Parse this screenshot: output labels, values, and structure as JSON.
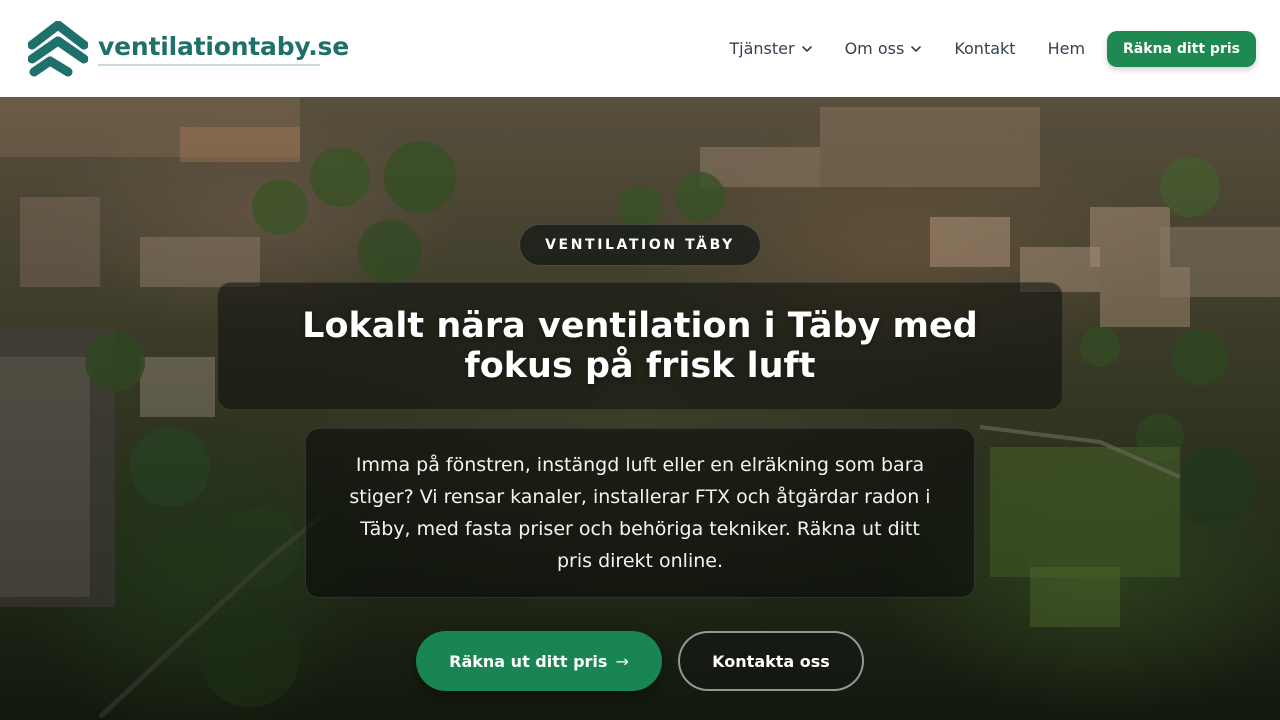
{
  "header": {
    "logo_text": "ventilationtaby.se",
    "logo_icon": "stacked-chevron-roof-icon",
    "nav": [
      {
        "label": "Tjänster",
        "has_dropdown": true
      },
      {
        "label": "Om oss",
        "has_dropdown": true
      },
      {
        "label": "Kontakt",
        "has_dropdown": false
      },
      {
        "label": "Hem",
        "has_dropdown": false
      }
    ],
    "cta_label": "Räkna ditt pris"
  },
  "hero": {
    "eyebrow": "VENTILATION TÄBY",
    "title": "Lokalt nära ventilation i Täby med fokus på frisk luft",
    "description": "Imma på fönstren, instängd luft eller en elräkning som bara stiger? Vi rensar kanaler, installerar FTX och åtgärdar radon i Täby, med fasta priser och behöriga tekniker. Räkna ut ditt pris direkt online.",
    "primary_button": "Räkna ut ditt pris",
    "primary_button_icon": "arrow-right-icon",
    "secondary_button": "Kontakta oss",
    "background": "aerial-town-photo"
  },
  "colors": {
    "brand_teal": "#1f6f6a",
    "brand_green": "#1e8a52",
    "text_dark": "#374151"
  }
}
